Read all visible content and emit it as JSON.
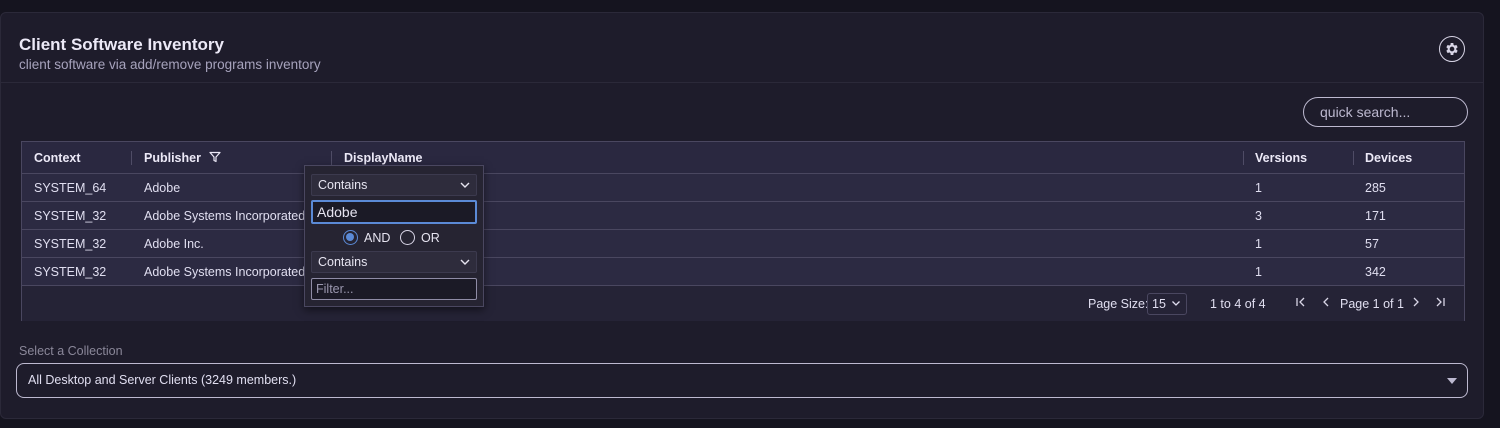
{
  "header": {
    "title": "Client Software Inventory",
    "subtitle": "client software via add/remove programs inventory"
  },
  "search": {
    "placeholder": "quick search..."
  },
  "grid": {
    "columns": [
      "Context",
      "Publisher",
      "DisplayName",
      "Versions",
      "Devices"
    ],
    "rows": [
      [
        "SYSTEM_64",
        "Adobe",
        "",
        "1",
        "285"
      ],
      [
        "SYSTEM_32",
        "Adobe Systems Incorporated",
        "",
        "3",
        "171"
      ],
      [
        "SYSTEM_32",
        "Adobe Inc.",
        "",
        "1",
        "57"
      ],
      [
        "SYSTEM_32",
        "Adobe Systems Incorporated",
        "",
        "1",
        "342"
      ]
    ],
    "footer": {
      "page_size_label": "Page Size:",
      "page_size_value": "15",
      "range": "1 to 4 of 4",
      "page_text": "Page 1 of 1"
    }
  },
  "filter_popup": {
    "condition1": "Contains",
    "value1": "Adobe",
    "and_label": "AND",
    "or_label": "OR",
    "selected_join": "AND",
    "condition2": "Contains",
    "value2_placeholder": "Filter..."
  },
  "collection": {
    "label": "Select a Collection",
    "value": "All Desktop and Server Clients (3249 members.)"
  },
  "colors": {
    "accent": "#5b8ad6",
    "background": "#15141f",
    "card": "#1e1c2b"
  }
}
